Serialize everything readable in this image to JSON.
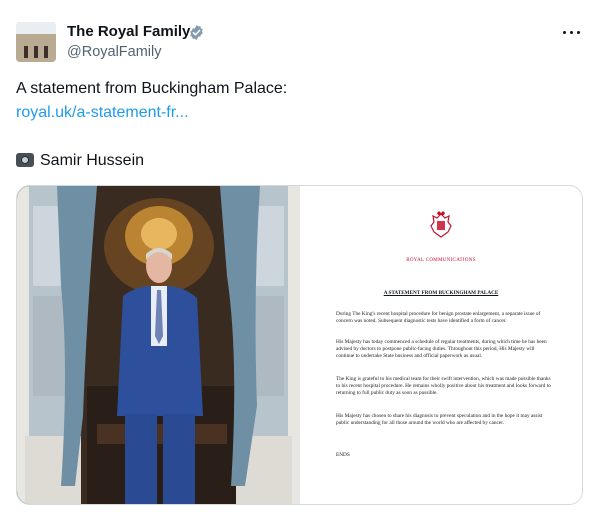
{
  "tweet": {
    "author_name": "The Royal Family",
    "author_handle": "@RoyalFamily",
    "text_line": "A statement from Buckingham Palace:",
    "link_text": "royal.uk/a-statement-fr...",
    "photo_credit": "Samir Hussein",
    "icons": [
      "verified-badge-icon",
      "more-options-icon",
      "camera-icon"
    ],
    "colors": {
      "link": "#1d9bf0",
      "handle": "#536471",
      "verified": "#829aab"
    }
  },
  "statement": {
    "office": "ROYAL COMMUNICATIONS",
    "title": "A STATEMENT FROM BUCKINGHAM PALACE",
    "paragraphs": [
      "During The King's recent hospital procedure for benign prostate enlargement, a separate issue of concern was noted. Subsequent diagnostic tests have identified a form of cancer.",
      "His Majesty has today commenced a schedule of regular treatments, during which time he has been advised by doctors to postpone public-facing duties. Throughout this period, His Majesty will continue to undertake State business and official paperwork as usual.",
      "The King is grateful to his medical team for their swift intervention, which was made possible thanks to his recent hospital procedure. He remains wholly positive about his treatment and looks forward to returning to full public duty as soon as possible.",
      "His Majesty has chosen to share his diagnosis to prevent speculation and in the hope it may assist public understanding for all those around the world who are affected by cancer."
    ],
    "ends": "ENDS"
  }
}
